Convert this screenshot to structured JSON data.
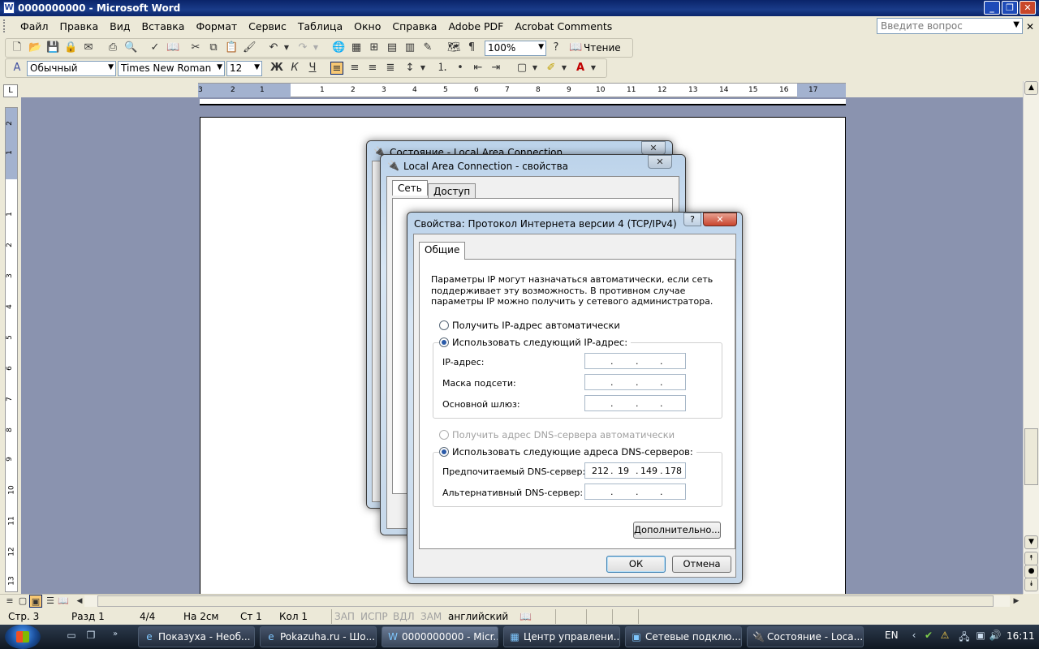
{
  "window": {
    "title": "0000000000 - Microsoft Word",
    "icon": "W"
  },
  "menu": [
    "Файл",
    "Правка",
    "Вид",
    "Вставка",
    "Формат",
    "Сервис",
    "Таблица",
    "Окно",
    "Справка",
    "Adobe PDF",
    "Acrobat Comments"
  ],
  "ask": {
    "placeholder": "Введите вопрос"
  },
  "toolbar": {
    "zoom": "100%",
    "reading": "Чтение",
    "style": "Обычный",
    "font": "Times New Roman",
    "size": "12"
  },
  "ruler": {
    "corner": "L",
    "h_numbers": [
      "3",
      "2",
      "1",
      "1",
      "2",
      "3",
      "4",
      "5",
      "6",
      "7",
      "8",
      "9",
      "10",
      "11",
      "12",
      "13",
      "14",
      "15",
      "16",
      "17"
    ],
    "v_numbers": [
      "2",
      "1",
      "1",
      "2",
      "3",
      "4",
      "5",
      "6",
      "7",
      "8",
      "9",
      "10",
      "11",
      "12",
      "13"
    ]
  },
  "status": {
    "page": "Стр. 3",
    "section": "Разд 1",
    "pages": "4/4",
    "at": "На 2см",
    "line": "Ст 1",
    "col": "Кол 1",
    "rec": "ЗАП",
    "trk": "ИСПР",
    "ext": "ВДЛ",
    "ovr": "ЗАМ",
    "lang": "английский"
  },
  "dialogs": {
    "status": {
      "title": "Состояние - Local Area Connection"
    },
    "props": {
      "title": "Local Area Connection - свойства",
      "tabs": [
        "Сеть",
        "Доступ"
      ]
    },
    "tcp": {
      "title": "Свойства: Протокол Интернета версии 4 (TCP/IPv4)",
      "tab": "Общие",
      "desc": "Параметры IP могут назначаться автоматически, если сеть поддерживает эту возможность. В противном случае параметры IP можно получить у сетевого администратора.",
      "radio_auto_ip": "Получить IP-адрес автоматически",
      "radio_manual_ip": "Использовать следующий IP-адрес:",
      "ip_label": "IP-адрес:",
      "mask_label": "Маска подсети:",
      "gateway_label": "Основной шлюз:",
      "radio_auto_dns": "Получить адрес DNS-сервера автоматически",
      "radio_manual_dns": "Использовать следующие адреса DNS-серверов:",
      "pref_dns_label": "Предпочитаемый DNS-сервер:",
      "alt_dns_label": "Альтернативный DNS-сервер:",
      "pref_dns": [
        "212",
        "19",
        "149",
        "178"
      ],
      "advanced": "Дополнительно...",
      "ok": "ОК",
      "cancel": "Отмена"
    }
  },
  "taskbar": {
    "items": [
      {
        "label": "Показуха - Необ..."
      },
      {
        "label": "Pokazuha.ru - Шо..."
      },
      {
        "label": "0000000000 - Micr..."
      },
      {
        "label": "Центр управлени..."
      },
      {
        "label": "Сетевые подклю..."
      },
      {
        "label": "Состояние - Loca..."
      }
    ],
    "lang": "EN",
    "time": "16:11"
  }
}
